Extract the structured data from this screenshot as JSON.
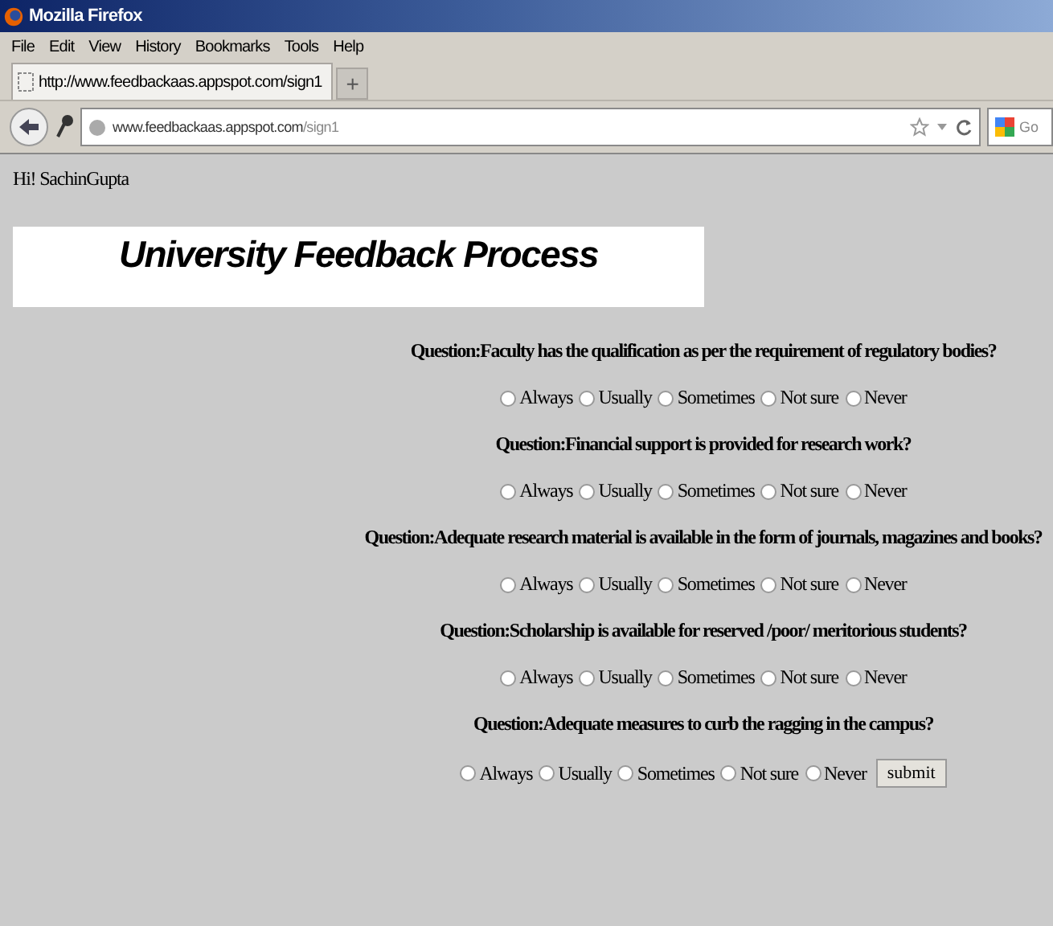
{
  "window": {
    "title": "Mozilla Firefox"
  },
  "menu": [
    "File",
    "Edit",
    "View",
    "History",
    "Bookmarks",
    "Tools",
    "Help"
  ],
  "tab": {
    "label": "http://www.feedbackaas.appspot.com/sign1",
    "new_tab": "+"
  },
  "address": {
    "domain": "www.feedbackaas.appspot.com",
    "path": "/sign1"
  },
  "search": {
    "placeholder": "Go"
  },
  "greeting": "Hi! SachinGupta",
  "heading": "University Feedback Process",
  "questions": [
    {
      "text": "Question:Faculty has the qualification as per the requirement of regulatory bodies?",
      "options": [
        {
          "label": "Always",
          "selected": false
        },
        {
          "label": "Usually",
          "selected": false
        },
        {
          "label": "Sometimes",
          "selected": false
        },
        {
          "label": "Not sure",
          "selected": false
        },
        {
          "label": "Never",
          "selected": false
        }
      ]
    },
    {
      "text": "Question:Financial support is provided for research work?",
      "options": [
        {
          "label": "Always",
          "selected": false
        },
        {
          "label": "Usually",
          "selected": false
        },
        {
          "label": "Sometimes",
          "selected": false
        },
        {
          "label": "Not sure",
          "selected": false
        },
        {
          "label": "Never",
          "selected": false
        }
      ]
    },
    {
      "text": "Question:Adequate research material is available in the form of journals, magazines and books?",
      "options": [
        {
          "label": "Always",
          "selected": false
        },
        {
          "label": "Usually",
          "selected": false
        },
        {
          "label": "Sometimes",
          "selected": false
        },
        {
          "label": "Not sure",
          "selected": false
        },
        {
          "label": "Never",
          "selected": false
        }
      ]
    },
    {
      "text": "Question:Scholarship is available for reserved /poor/ meritorious students?",
      "options": [
        {
          "label": "Always",
          "selected": false
        },
        {
          "label": "Usually",
          "selected": false
        },
        {
          "label": "Sometimes",
          "selected": false
        },
        {
          "label": "Not sure",
          "selected": false
        },
        {
          "label": "Never",
          "selected": false
        }
      ]
    },
    {
      "text": "Question:Adequate measures to curb the ragging in the campus?",
      "options": [
        {
          "label": "Always",
          "selected": false
        },
        {
          "label": "Usually",
          "selected": false
        },
        {
          "label": "Sometimes",
          "selected": false
        },
        {
          "label": "Not sure",
          "selected": false
        },
        {
          "label": "Never",
          "selected": false
        }
      ]
    }
  ],
  "submit": "submit"
}
